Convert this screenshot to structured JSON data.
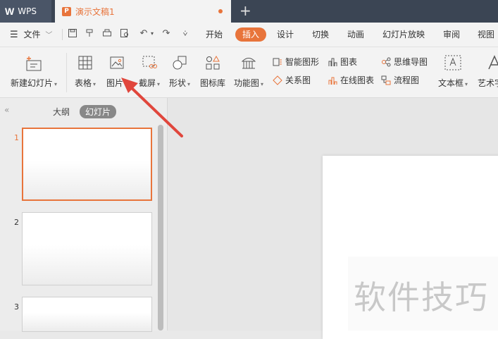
{
  "app": {
    "name": "WPS",
    "document_title": "演示文稿1",
    "new_tab_symbol": "+"
  },
  "menubar": {
    "file_label": "文件",
    "tabs": [
      "开始",
      "插入",
      "设计",
      "切换",
      "动画",
      "幻灯片放映",
      "审阅",
      "视图"
    ],
    "active_tab": "插入"
  },
  "ribbon": {
    "new_slide": "新建幻灯片",
    "table": "表格",
    "picture": "图片",
    "screenshot": "截屏",
    "shape": "形状",
    "icon_lib": "图标库",
    "func_chart": "功能图",
    "smart_art": "智能图形",
    "chart": "图表",
    "relation": "关系图",
    "online_chart": "在线图表",
    "mind_map": "思维导图",
    "flow_chart": "流程图",
    "text_box": "文本框",
    "word_art": "艺术字"
  },
  "panel": {
    "tab_outline": "大纲",
    "tab_slides": "幻灯片",
    "slides": [
      {
        "number": "1"
      },
      {
        "number": "2"
      },
      {
        "number": "3"
      }
    ],
    "selected_slide": "1"
  },
  "watermark": "软件技巧",
  "colors": {
    "accent": "#e8743b",
    "titlebar": "#3b4554",
    "annotation_arrow": "#e0463c"
  }
}
